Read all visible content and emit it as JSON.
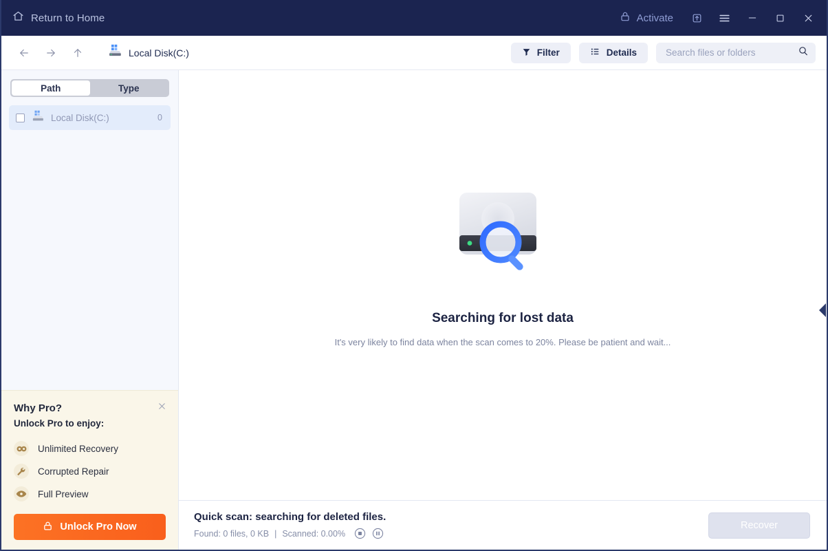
{
  "titlebar": {
    "home_label": "Return to Home",
    "activate_label": "Activate",
    "home_icon": "home-icon",
    "lock_icon": "lock-icon",
    "export_icon": "export-icon",
    "menu_icon": "hamburger-menu-icon",
    "minimize_icon": "minimize-icon",
    "maximize_icon": "maximize-icon",
    "close_icon": "close-icon",
    "bg_color": "#1b2450",
    "text_color": "#b9c2e0",
    "accent_color": "#8f9dd4"
  },
  "toolbar": {
    "back_icon": "arrow-left-icon",
    "forward_icon": "arrow-right-icon",
    "up_icon": "arrow-up-icon",
    "breadcrumb_label": "Local Disk(C:)",
    "breadcrumb_icon": "windows-disk-icon",
    "filter_label": "Filter",
    "filter_icon": "funnel-icon",
    "details_label": "Details",
    "details_icon": "list-icon",
    "search_placeholder": "Search files or folders",
    "search_value": "",
    "search_icon": "search-icon"
  },
  "sidebar": {
    "tabs": [
      {
        "label": "Path",
        "active": true
      },
      {
        "label": "Type",
        "active": false
      }
    ],
    "disks": [
      {
        "label": "Local Disk(C:)",
        "count": "0",
        "checked": false,
        "icon": "windows-disk-icon"
      }
    ]
  },
  "whypro": {
    "title": "Why Pro?",
    "subtitle": "Unlock Pro to enjoy:",
    "close_icon": "close-icon",
    "features": [
      {
        "label": "Unlimited Recovery",
        "icon": "infinity-icon"
      },
      {
        "label": "Corrupted Repair",
        "icon": "wrench-icon"
      },
      {
        "label": "Full Preview",
        "icon": "eye-icon"
      }
    ],
    "cta_label": "Unlock Pro Now",
    "cta_icon": "lock-icon",
    "bg_color": "#faf6e9",
    "cta_color": "#fc7224"
  },
  "main": {
    "illustration_icon": "disk-search-icon",
    "title": "Searching for lost data",
    "subtitle": "It's very likely to find data when the scan comes to 20%. Please be patient and wait...",
    "panel_handle_icon": "triangle-left-icon"
  },
  "statusbar": {
    "scan_title": "Quick scan: searching for deleted files.",
    "found_text": "Found: 0 files, 0 KB",
    "separator": "|",
    "scanned_text": "Scanned: 0.00%",
    "stop_icon": "stop-circle-icon",
    "pause_icon": "pause-circle-icon",
    "recover_label": "Recover",
    "recover_enabled": false
  }
}
